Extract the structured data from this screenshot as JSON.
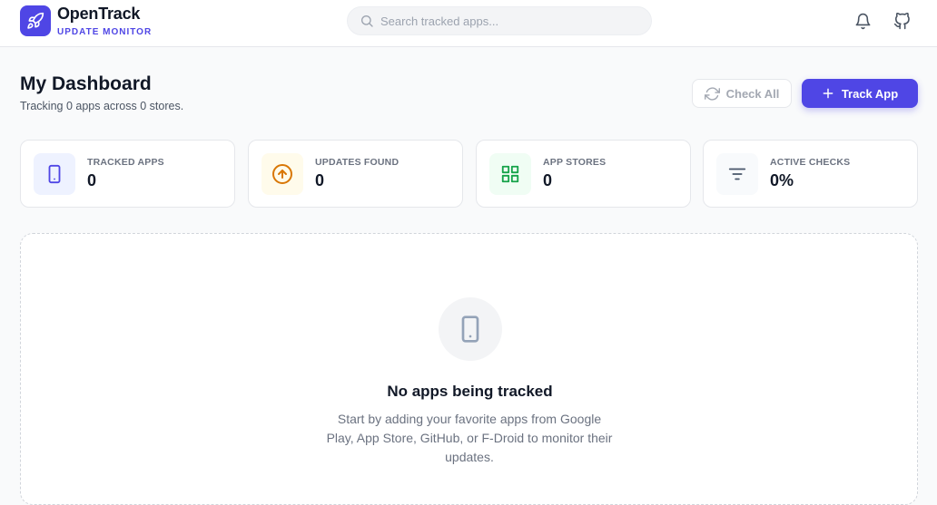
{
  "brand": {
    "name": "OpenTrack",
    "subtitle": "UPDATE MONITOR",
    "icon": "rocket-icon"
  },
  "search": {
    "placeholder": "Search tracked apps...",
    "value": ""
  },
  "header_icons": [
    "bell-icon",
    "github-icon"
  ],
  "dashboard": {
    "title": "My Dashboard",
    "subtitle": "Tracking 0 apps across 0 stores.",
    "check_all_label": "Check All",
    "track_app_label": "Track App"
  },
  "stats": [
    {
      "label": "TRACKED APPS",
      "value": "0",
      "icon": "smartphone-icon",
      "color": "#4f46e5",
      "bg": "#eef2ff"
    },
    {
      "label": "UPDATES FOUND",
      "value": "0",
      "icon": "arrow-up-circle-icon",
      "color": "#d97706",
      "bg": "#fffbeb"
    },
    {
      "label": "APP STORES",
      "value": "0",
      "icon": "grid-icon",
      "color": "#16a34a",
      "bg": "#f0fdf4"
    },
    {
      "label": "ACTIVE CHECKS",
      "value": "0%",
      "icon": "filter-lines-icon",
      "color": "#475569",
      "bg": "#f8fafc"
    }
  ],
  "empty_state": {
    "icon": "smartphone-icon",
    "title": "No apps being tracked",
    "description": "Start by adding your favorite apps from Google Play, App Store, GitHub, or F-Droid to monitor their updates."
  },
  "colors": {
    "accent": "#4f46e5",
    "background": "#f9fafb"
  }
}
